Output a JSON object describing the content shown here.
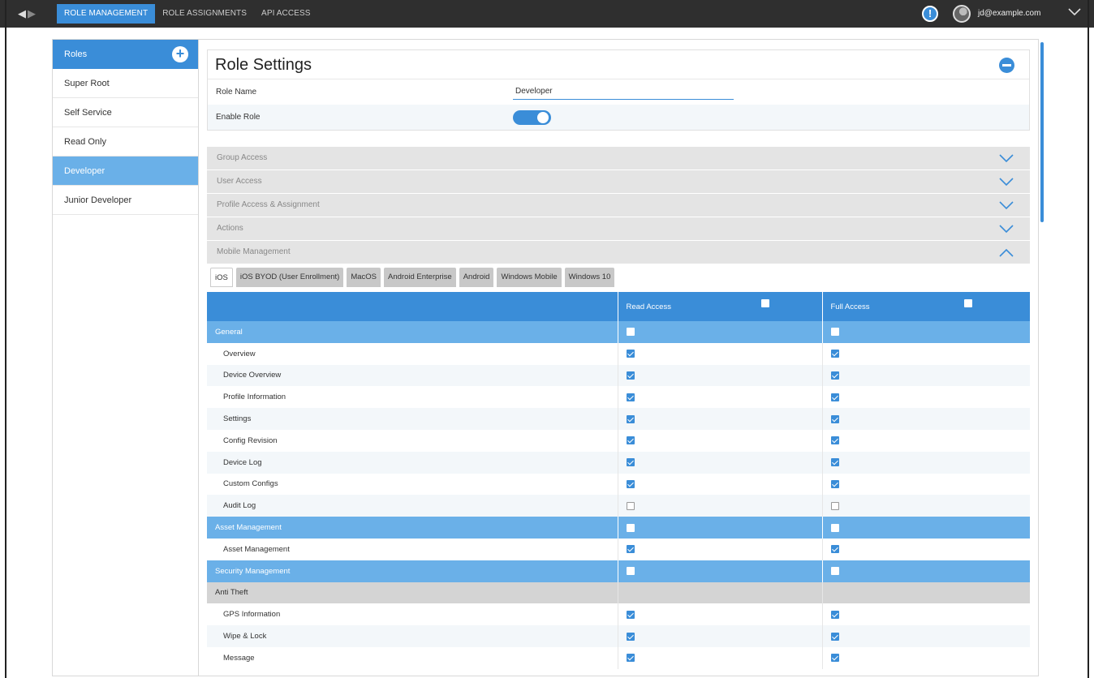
{
  "topbar": {
    "nav": [
      {
        "label": "ROLE MANAGEMENT",
        "active": true
      },
      {
        "label": "ROLE ASSIGNMENTS",
        "active": false
      },
      {
        "label": "API ACCESS",
        "active": false
      }
    ],
    "user_email": "jd@example.com",
    "alert_glyph": "!",
    "accent_color": "#3a8dd8"
  },
  "sidebar": {
    "header": "Roles",
    "add_glyph": "+",
    "roles": [
      {
        "label": "Super Root",
        "selected": false
      },
      {
        "label": "Self Service",
        "selected": false
      },
      {
        "label": "Read Only",
        "selected": false
      },
      {
        "label": "Developer",
        "selected": true
      },
      {
        "label": "Junior Developer",
        "selected": false
      }
    ]
  },
  "settings": {
    "title": "Role Settings",
    "role_name_label": "Role Name",
    "role_name_value": "Developer",
    "enable_label": "Enable Role",
    "enabled": true
  },
  "accordion": [
    {
      "label": "Group Access",
      "expanded": false
    },
    {
      "label": "User Access",
      "expanded": false
    },
    {
      "label": "Profile Access & Assignment",
      "expanded": false
    },
    {
      "label": "Actions",
      "expanded": false
    },
    {
      "label": "Mobile Management",
      "expanded": true
    }
  ],
  "tabs": [
    {
      "label": "iOS",
      "active": true
    },
    {
      "label": "iOS BYOD (User Enrollment)",
      "active": false
    },
    {
      "label": "MacOS",
      "active": false
    },
    {
      "label": "Android Enterprise",
      "active": false
    },
    {
      "label": "Android",
      "active": false
    },
    {
      "label": "Windows Mobile",
      "active": false
    },
    {
      "label": "Windows 10",
      "active": false
    }
  ],
  "table": {
    "read_header": "Read Access",
    "full_header": "Full Access",
    "rows": [
      {
        "type": "cat",
        "label": "General",
        "read": false,
        "full": false
      },
      {
        "type": "item",
        "label": "Overview",
        "read": true,
        "full": true
      },
      {
        "type": "item",
        "label": "Device Overview",
        "read": true,
        "full": true
      },
      {
        "type": "item",
        "label": "Profile Information",
        "read": true,
        "full": true
      },
      {
        "type": "item",
        "label": "Settings",
        "read": true,
        "full": true
      },
      {
        "type": "item",
        "label": "Config Revision",
        "read": true,
        "full": true
      },
      {
        "type": "item",
        "label": "Device Log",
        "read": true,
        "full": true
      },
      {
        "type": "item",
        "label": "Custom Configs",
        "read": true,
        "full": true
      },
      {
        "type": "item",
        "label": "Audit Log",
        "read": false,
        "full": false
      },
      {
        "type": "cat",
        "label": "Asset Management",
        "read": false,
        "full": false
      },
      {
        "type": "item",
        "label": "Asset Management",
        "read": true,
        "full": true
      },
      {
        "type": "cat",
        "label": "Security Management",
        "read": false,
        "full": false
      },
      {
        "type": "sub",
        "label": "Anti Theft"
      },
      {
        "type": "item",
        "label": "GPS Information",
        "read": true,
        "full": true
      },
      {
        "type": "item",
        "label": "Wipe & Lock",
        "read": true,
        "full": true
      },
      {
        "type": "item",
        "label": "Message",
        "read": true,
        "full": true
      }
    ]
  }
}
